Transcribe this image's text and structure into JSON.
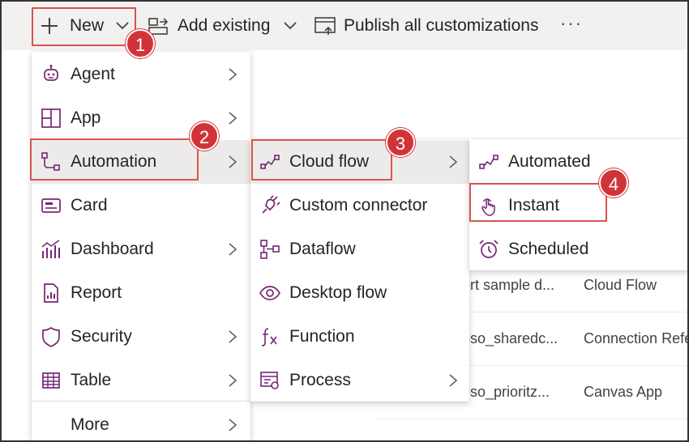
{
  "toolbar": {
    "new_label": "New",
    "add_existing_label": "Add existing",
    "publish_label": "Publish all customizations",
    "more_label": "···"
  },
  "background_rows": [
    {
      "name": "ort sample d...",
      "type": "Cloud Flow"
    },
    {
      "name": "oso_sharedc...",
      "type": "Connection Refe"
    },
    {
      "name": "oso_prioritz...",
      "type": "Canvas App"
    }
  ],
  "new_menu": {
    "items": [
      {
        "label": "Agent",
        "icon": "agent-icon",
        "submenu": true
      },
      {
        "label": "App",
        "icon": "app-icon",
        "submenu": true
      },
      {
        "label": "Automation",
        "icon": "automation-icon",
        "submenu": true,
        "highlighted": true
      },
      {
        "label": "Card",
        "icon": "card-icon",
        "submenu": false
      },
      {
        "label": "Dashboard",
        "icon": "dashboard-icon",
        "submenu": true
      },
      {
        "label": "Report",
        "icon": "report-icon",
        "submenu": false
      },
      {
        "label": "Security",
        "icon": "shield-icon",
        "submenu": true
      },
      {
        "label": "Table",
        "icon": "table-icon",
        "submenu": true
      },
      {
        "label": "More",
        "icon": "",
        "submenu": true
      }
    ]
  },
  "automation_menu": {
    "items": [
      {
        "label": "Cloud flow",
        "icon": "cloud-flow-icon",
        "submenu": true,
        "highlighted": true
      },
      {
        "label": "Custom connector",
        "icon": "connector-icon",
        "submenu": false
      },
      {
        "label": "Dataflow",
        "icon": "dataflow-icon",
        "submenu": false
      },
      {
        "label": "Desktop flow",
        "icon": "eye-icon",
        "submenu": false
      },
      {
        "label": "Function",
        "icon": "function-icon",
        "submenu": false
      },
      {
        "label": "Process",
        "icon": "process-icon",
        "submenu": true
      }
    ]
  },
  "cloud_flow_menu": {
    "items": [
      {
        "label": "Automated",
        "icon": "automated-icon"
      },
      {
        "label": "Instant",
        "icon": "touch-icon"
      },
      {
        "label": "Scheduled",
        "icon": "alarm-clock-icon"
      }
    ]
  },
  "annotations": {
    "step1": "1",
    "step2": "2",
    "step3": "3",
    "step4": "4"
  },
  "colors": {
    "accent_purple": "#742774",
    "callout_red": "#d13438",
    "toolbar_bg": "#f2f1f0",
    "highlight_bg": "#edebe9"
  }
}
